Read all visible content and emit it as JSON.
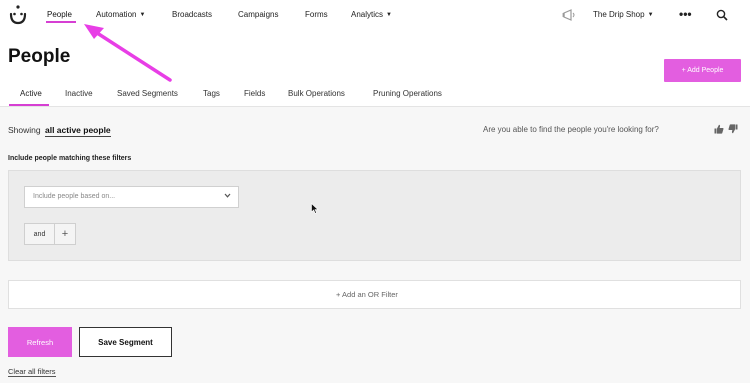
{
  "nav": {
    "logo_icon": "drip-smile-logo-icon",
    "items": [
      {
        "label": "People"
      },
      {
        "label": "Automation",
        "caret": "▼"
      },
      {
        "label": "Broadcasts"
      },
      {
        "label": "Campaigns"
      },
      {
        "label": "Forms"
      },
      {
        "label": "Analytics",
        "caret": "▼"
      }
    ],
    "account": {
      "label": "The Drip Shop",
      "caret": "▼"
    },
    "more": "•••",
    "icons": [
      "megaphone-icon",
      "more-icon",
      "search-icon"
    ]
  },
  "page": {
    "title": "People",
    "add_button": "+ Add People"
  },
  "tabs": [
    "Active",
    "Inactive",
    "Saved Segments",
    "Tags",
    "Fields",
    "Bulk Operations",
    "Pruning Operations"
  ],
  "showing": {
    "prefix": "Showing",
    "value": "all active people",
    "feedback_question": "Are you able to find the people you're looking for?"
  },
  "filters": {
    "heading": "Include people matching these filters",
    "select_placeholder": "Include people based on...",
    "and_label": "and",
    "plus_label": "+",
    "or_filter_label": "+ Add an OR Filter"
  },
  "actions": {
    "refresh": "Refresh",
    "save_segment": "Save Segment",
    "clear_filters": "Clear all filters"
  },
  "colors": {
    "accent": "#e35ee0",
    "arrow": "#e83ee6",
    "background_gray": "#f7f7f7"
  }
}
